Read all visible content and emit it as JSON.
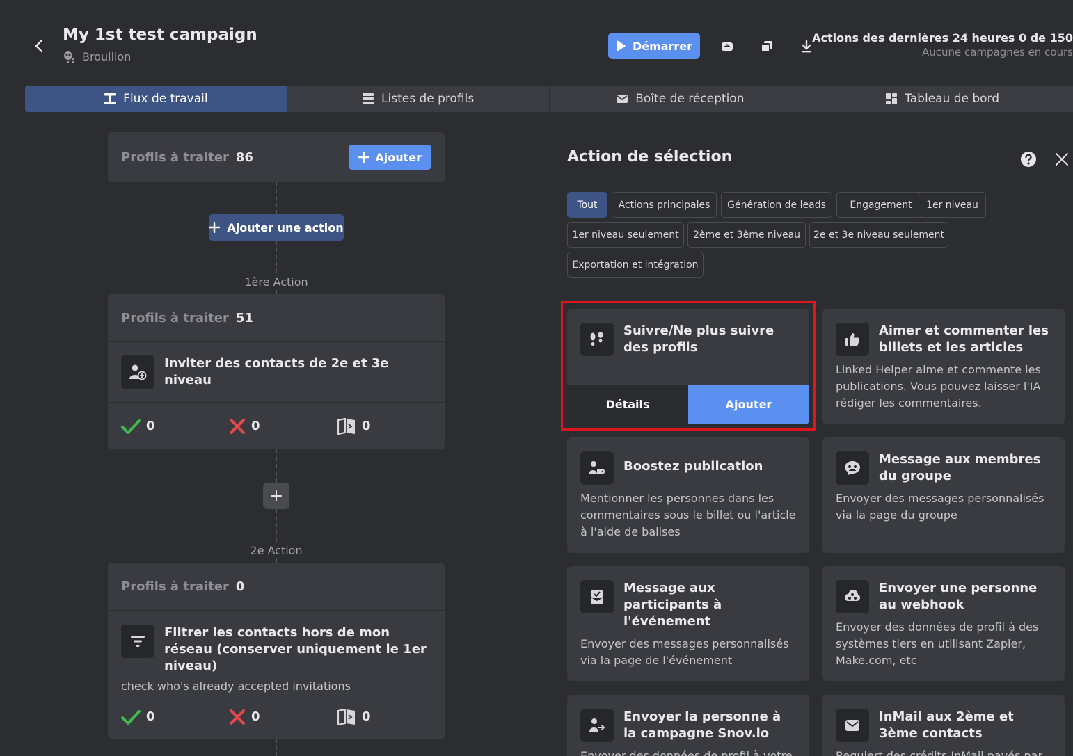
{
  "header": {
    "title": "My 1st test campaign",
    "status": "Brouillon",
    "start_label": "Démarrer",
    "actions_line1": "Actions des dernières 24 heures 0 de 150",
    "actions_line2": "Aucune campagnes en cours"
  },
  "tabs": [
    {
      "label": "Flux de travail",
      "icon": "workflow-icon",
      "active": true
    },
    {
      "label": "Listes de profils",
      "icon": "list-icon",
      "active": false
    },
    {
      "label": "Boîte de réception",
      "icon": "mail-icon",
      "active": false
    },
    {
      "label": "Tableau de bord",
      "icon": "dashboard-icon",
      "active": false
    }
  ],
  "workflow": {
    "top_card": {
      "label": "Profils à traiter",
      "count": "86",
      "add_label": "Ajouter"
    },
    "add_action_label": "Ajouter une action",
    "step1_label": "1ère Action",
    "step1": {
      "label": "Profils à traiter",
      "count": "51",
      "title": "Inviter des contacts de 2e et 3e niveau",
      "success": "0",
      "failed": "0",
      "skipped": "0"
    },
    "step2_label": "2e Action",
    "step2": {
      "label": "Profils à traiter",
      "count": "0",
      "title": "Filtrer les contacts hors de mon réseau (conserver uniquement le 1er niveau)",
      "note": "check who's already accepted invitations",
      "success": "0",
      "failed": "0",
      "skipped": "0"
    }
  },
  "panel": {
    "title": "Action de sélection",
    "filters": [
      "Tout",
      "Actions principales",
      "Génération de leads",
      "Engagement",
      "1er niveau",
      "1er niveau seulement",
      "2ème et 3ème niveau",
      "2e et 3e niveau seulement",
      "Exportation et intégration"
    ],
    "selected_card": {
      "title": "Suivre/Ne plus suivre des profils",
      "details_label": "Détails",
      "add_label": "Ajouter"
    },
    "cards": [
      {
        "title": "Aimer et commenter les billets et les articles",
        "desc": "Linked Helper aime et commente les publications. Vous pouvez laisser l'IA rédiger les commentaires."
      },
      {
        "title": "Boostez publication",
        "desc": "Mentionner les personnes dans les commentaires sous le billet ou l'article à l'aide de balises"
      },
      {
        "title": "Message aux membres du groupe",
        "desc": "Envoyer des messages personnalisés via la page du groupe"
      },
      {
        "title": "Message aux participants à l'événement",
        "desc": "Envoyer des messages personnalisés via la page de l'événement"
      },
      {
        "title": "Envoyer une personne au webhook",
        "desc": "Envoyer des données de profil à des systèmes tiers en utilisant Zapier, Make.com, etc"
      },
      {
        "title": "Envoyer la personne à la campagne Snov.io",
        "desc": "Envoyer des données de profil à votre"
      },
      {
        "title": "InMail aux 2ème et 3ème contacts",
        "desc": "Requiert des crédits InMail payés par"
      }
    ]
  },
  "colors": {
    "accent": "#5b8ff0",
    "active_tab": "#3e5485",
    "success": "#3fb950",
    "error": "#e5484d",
    "selection": "#e0161e"
  }
}
